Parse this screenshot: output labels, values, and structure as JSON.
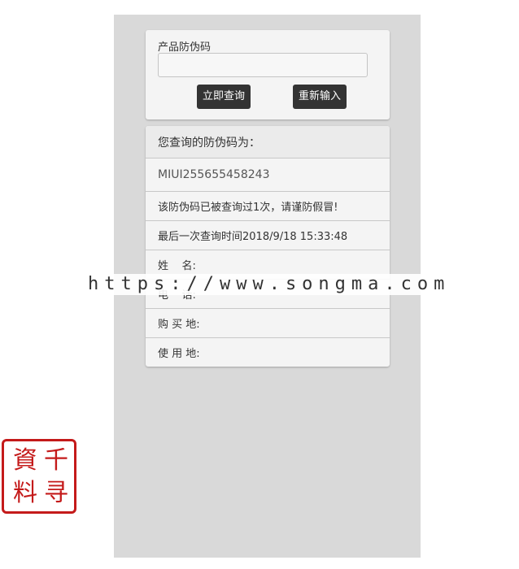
{
  "query_form": {
    "label": "产品防伪码",
    "input_value": "",
    "input_placeholder": "",
    "query_button": "立即查询",
    "reset_button": "重新输入"
  },
  "result": {
    "header": "您查询的防伪码为：",
    "code": "MIUI255655458243",
    "notice": "该防伪码已被查询过1次，请谨防假冒!",
    "last_query": "最后一次查询时间2018/9/18 15:33:48",
    "name_label": "姓    名:",
    "phone_label": "电    话:",
    "purchase_place_label": "购 买 地:",
    "use_place_label": "使 用 地:"
  },
  "overlay": {
    "watermark_text": "https://www.songma.com"
  },
  "seal": {
    "chars": [
      "資",
      "千",
      "料",
      "寻"
    ],
    "color": "#c41a1a"
  },
  "colors": {
    "button_bg": "#333333",
    "page_bg": "#d9d9d9",
    "card_bg": "#f4f4f4"
  }
}
